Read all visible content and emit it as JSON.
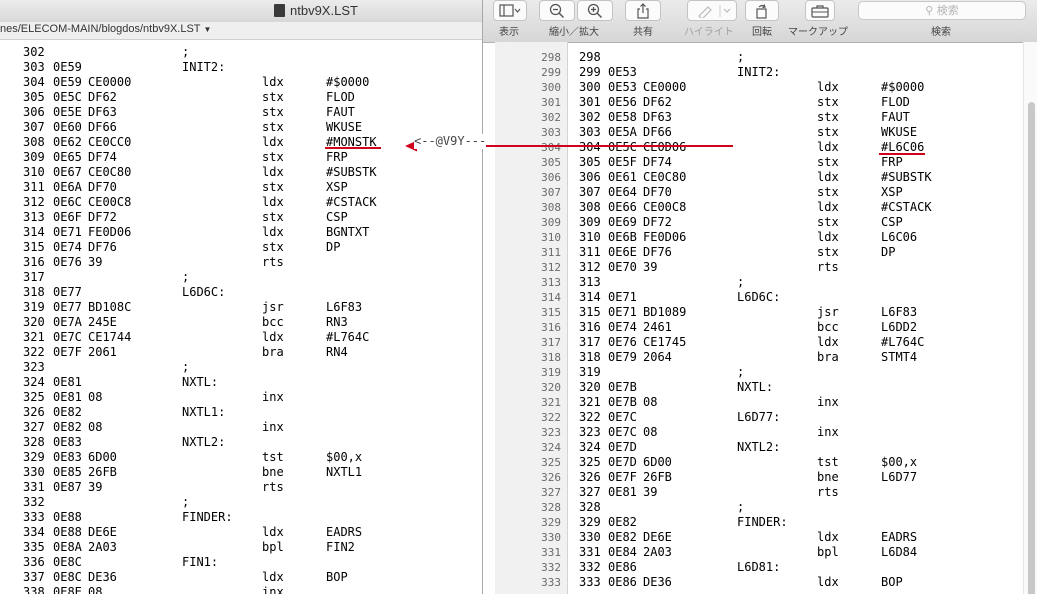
{
  "left_window": {
    "title": "ntbv9X.LST",
    "path": "nes/ELECOM-MAIN/blogdos/ntbv9X.LST",
    "lines": [
      {
        "c1": "302",
        "c2": "",
        "c3": "",
        "c4": ";",
        "c5": "",
        "c6": ""
      },
      {
        "c1": "303",
        "c2": "0E59",
        "c3": "",
        "c4": "INIT2:",
        "c5": "",
        "c6": ""
      },
      {
        "c1": "304",
        "c2": "0E59",
        "c3": "CE0000",
        "c4": "",
        "c5": "ldx",
        "c6": "#$0000"
      },
      {
        "c1": "305",
        "c2": "0E5C",
        "c3": "DF62",
        "c4": "",
        "c5": "stx",
        "c6": "FLOD"
      },
      {
        "c1": "306",
        "c2": "0E5E",
        "c3": "DF63",
        "c4": "",
        "c5": "stx",
        "c6": "FAUT"
      },
      {
        "c1": "307",
        "c2": "0E60",
        "c3": "DF66",
        "c4": "",
        "c5": "stx",
        "c6": "WKUSE"
      },
      {
        "c1": "308",
        "c2": "0E62",
        "c3": "CE0CC0",
        "c4": "",
        "c5": "ldx",
        "c6": "#MONSTK"
      },
      {
        "c1": "309",
        "c2": "0E65",
        "c3": "DF74",
        "c4": "",
        "c5": "stx",
        "c6": "FRP"
      },
      {
        "c1": "310",
        "c2": "0E67",
        "c3": "CE0C80",
        "c4": "",
        "c5": "ldx",
        "c6": "#SUBSTK"
      },
      {
        "c1": "311",
        "c2": "0E6A",
        "c3": "DF70",
        "c4": "",
        "c5": "stx",
        "c6": "XSP"
      },
      {
        "c1": "312",
        "c2": "0E6C",
        "c3": "CE00C8",
        "c4": "",
        "c5": "ldx",
        "c6": "#CSTACK"
      },
      {
        "c1": "313",
        "c2": "0E6F",
        "c3": "DF72",
        "c4": "",
        "c5": "stx",
        "c6": "CSP"
      },
      {
        "c1": "314",
        "c2": "0E71",
        "c3": "FE0D06",
        "c4": "",
        "c5": "ldx",
        "c6": "BGNTXT"
      },
      {
        "c1": "315",
        "c2": "0E74",
        "c3": "DF76",
        "c4": "",
        "c5": "stx",
        "c6": "DP"
      },
      {
        "c1": "316",
        "c2": "0E76",
        "c3": "39",
        "c4": "",
        "c5": "rts",
        "c6": ""
      },
      {
        "c1": "317",
        "c2": "",
        "c3": "",
        "c4": ";",
        "c5": "",
        "c6": ""
      },
      {
        "c1": "318",
        "c2": "0E77",
        "c3": "",
        "c4": "L6D6C:",
        "c5": "",
        "c6": ""
      },
      {
        "c1": "319",
        "c2": "0E77",
        "c3": "BD108C",
        "c4": "",
        "c5": "jsr",
        "c6": "L6F83"
      },
      {
        "c1": "320",
        "c2": "0E7A",
        "c3": "245E",
        "c4": "",
        "c5": "bcc",
        "c6": "RN3"
      },
      {
        "c1": "321",
        "c2": "0E7C",
        "c3": "CE1744",
        "c4": "",
        "c5": "ldx",
        "c6": "#L764C"
      },
      {
        "c1": "322",
        "c2": "0E7F",
        "c3": "2061",
        "c4": "",
        "c5": "bra",
        "c6": "RN4"
      },
      {
        "c1": "323",
        "c2": "",
        "c3": "",
        "c4": ";",
        "c5": "",
        "c6": ""
      },
      {
        "c1": "324",
        "c2": "0E81",
        "c3": "",
        "c4": "NXTL:",
        "c5": "",
        "c6": ""
      },
      {
        "c1": "325",
        "c2": "0E81",
        "c3": "08",
        "c4": "",
        "c5": "inx",
        "c6": ""
      },
      {
        "c1": "326",
        "c2": "0E82",
        "c3": "",
        "c4": "NXTL1:",
        "c5": "",
        "c6": ""
      },
      {
        "c1": "327",
        "c2": "0E82",
        "c3": "08",
        "c4": "",
        "c5": "inx",
        "c6": ""
      },
      {
        "c1": "328",
        "c2": "0E83",
        "c3": "",
        "c4": "NXTL2:",
        "c5": "",
        "c6": ""
      },
      {
        "c1": "329",
        "c2": "0E83",
        "c3": "6D00",
        "c4": "",
        "c5": "tst",
        "c6": "$00,x"
      },
      {
        "c1": "330",
        "c2": "0E85",
        "c3": "26FB",
        "c4": "",
        "c5": "bne",
        "c6": "NXTL1"
      },
      {
        "c1": "331",
        "c2": "0E87",
        "c3": "39",
        "c4": "",
        "c5": "rts",
        "c6": ""
      },
      {
        "c1": "332",
        "c2": "",
        "c3": "",
        "c4": ";",
        "c5": "",
        "c6": ""
      },
      {
        "c1": "333",
        "c2": "0E88",
        "c3": "",
        "c4": "FINDER:",
        "c5": "",
        "c6": ""
      },
      {
        "c1": "334",
        "c2": "0E88",
        "c3": "DE6E",
        "c4": "",
        "c5": "ldx",
        "c6": "EADRS"
      },
      {
        "c1": "335",
        "c2": "0E8A",
        "c3": "2A03",
        "c4": "",
        "c5": "bpl",
        "c6": "FIN2"
      },
      {
        "c1": "336",
        "c2": "0E8C",
        "c3": "",
        "c4": "FIN1:",
        "c5": "",
        "c6": ""
      },
      {
        "c1": "337",
        "c2": "0E8C",
        "c3": "DE36",
        "c4": "",
        "c5": "ldx",
        "c6": "BOP"
      },
      {
        "c1": "338",
        "c2": "0E8E",
        "c3": "08",
        "c4": "",
        "c5": "inx",
        "c6": ""
      }
    ]
  },
  "annotation": {
    "label": "<--@V9Y---",
    "arrow_color": "#d0021b"
  },
  "toolbar": {
    "view_label": "表示",
    "zoom_label": "縮小／拡大",
    "share_label": "共有",
    "highlight_label": "ハイライト",
    "rotate_label": "回転",
    "markup_label": "マークアップ",
    "search_placeholder": "検索",
    "search_label": "検索"
  },
  "right_window": {
    "lines": [
      {
        "g": "298",
        "c1": "298",
        "c2": "",
        "c3": "",
        "c4": ";",
        "c5": "",
        "c6": ""
      },
      {
        "g": "299",
        "c1": "299",
        "c2": "0E53",
        "c3": "",
        "c4": "INIT2:",
        "c5": "",
        "c6": ""
      },
      {
        "g": "300",
        "c1": "300",
        "c2": "0E53",
        "c3": "CE0000",
        "c4": "",
        "c5": "ldx",
        "c6": "#$0000"
      },
      {
        "g": "301",
        "c1": "301",
        "c2": "0E56",
        "c3": "DF62",
        "c4": "",
        "c5": "stx",
        "c6": "FLOD"
      },
      {
        "g": "302",
        "c1": "302",
        "c2": "0E58",
        "c3": "DF63",
        "c4": "",
        "c5": "stx",
        "c6": "FAUT"
      },
      {
        "g": "303",
        "c1": "303",
        "c2": "0E5A",
        "c3": "DF66",
        "c4": "",
        "c5": "stx",
        "c6": "WKUSE"
      },
      {
        "g": "304",
        "c1": "304",
        "c2": "0E5C",
        "c3": "CE0D06",
        "c4": "",
        "c5": "ldx",
        "c6": "#L6C06"
      },
      {
        "g": "305",
        "c1": "305",
        "c2": "0E5F",
        "c3": "DF74",
        "c4": "",
        "c5": "stx",
        "c6": "FRP"
      },
      {
        "g": "306",
        "c1": "306",
        "c2": "0E61",
        "c3": "CE0C80",
        "c4": "",
        "c5": "ldx",
        "c6": "#SUBSTK"
      },
      {
        "g": "307",
        "c1": "307",
        "c2": "0E64",
        "c3": "DF70",
        "c4": "",
        "c5": "stx",
        "c6": "XSP"
      },
      {
        "g": "308",
        "c1": "308",
        "c2": "0E66",
        "c3": "CE00C8",
        "c4": "",
        "c5": "ldx",
        "c6": "#CSTACK"
      },
      {
        "g": "309",
        "c1": "309",
        "c2": "0E69",
        "c3": "DF72",
        "c4": "",
        "c5": "stx",
        "c6": "CSP"
      },
      {
        "g": "310",
        "c1": "310",
        "c2": "0E6B",
        "c3": "FE0D06",
        "c4": "",
        "c5": "ldx",
        "c6": "L6C06"
      },
      {
        "g": "311",
        "c1": "311",
        "c2": "0E6E",
        "c3": "DF76",
        "c4": "",
        "c5": "stx",
        "c6": "DP"
      },
      {
        "g": "312",
        "c1": "312",
        "c2": "0E70",
        "c3": "39",
        "c4": "",
        "c5": "rts",
        "c6": ""
      },
      {
        "g": "313",
        "c1": "313",
        "c2": "",
        "c3": "",
        "c4": ";",
        "c5": "",
        "c6": ""
      },
      {
        "g": "314",
        "c1": "314",
        "c2": "0E71",
        "c3": "",
        "c4": "L6D6C:",
        "c5": "",
        "c6": ""
      },
      {
        "g": "315",
        "c1": "315",
        "c2": "0E71",
        "c3": "BD1089",
        "c4": "",
        "c5": "jsr",
        "c6": "L6F83"
      },
      {
        "g": "316",
        "c1": "316",
        "c2": "0E74",
        "c3": "2461",
        "c4": "",
        "c5": "bcc",
        "c6": "L6DD2"
      },
      {
        "g": "317",
        "c1": "317",
        "c2": "0E76",
        "c3": "CE1745",
        "c4": "",
        "c5": "ldx",
        "c6": "#L764C"
      },
      {
        "g": "318",
        "c1": "318",
        "c2": "0E79",
        "c3": "2064",
        "c4": "",
        "c5": "bra",
        "c6": "STMT4"
      },
      {
        "g": "319",
        "c1": "319",
        "c2": "",
        "c3": "",
        "c4": ";",
        "c5": "",
        "c6": ""
      },
      {
        "g": "320",
        "c1": "320",
        "c2": "0E7B",
        "c3": "",
        "c4": "NXTL:",
        "c5": "",
        "c6": ""
      },
      {
        "g": "321",
        "c1": "321",
        "c2": "0E7B",
        "c3": "08",
        "c4": "",
        "c5": "inx",
        "c6": ""
      },
      {
        "g": "322",
        "c1": "322",
        "c2": "0E7C",
        "c3": "",
        "c4": "L6D77:",
        "c5": "",
        "c6": ""
      },
      {
        "g": "323",
        "c1": "323",
        "c2": "0E7C",
        "c3": "08",
        "c4": "",
        "c5": "inx",
        "c6": ""
      },
      {
        "g": "324",
        "c1": "324",
        "c2": "0E7D",
        "c3": "",
        "c4": "NXTL2:",
        "c5": "",
        "c6": ""
      },
      {
        "g": "325",
        "c1": "325",
        "c2": "0E7D",
        "c3": "6D00",
        "c4": "",
        "c5": "tst",
        "c6": "$00,x"
      },
      {
        "g": "326",
        "c1": "326",
        "c2": "0E7F",
        "c3": "26FB",
        "c4": "",
        "c5": "bne",
        "c6": "L6D77"
      },
      {
        "g": "327",
        "c1": "327",
        "c2": "0E81",
        "c3": "39",
        "c4": "",
        "c5": "rts",
        "c6": ""
      },
      {
        "g": "328",
        "c1": "328",
        "c2": "",
        "c3": "",
        "c4": ";",
        "c5": "",
        "c6": ""
      },
      {
        "g": "329",
        "c1": "329",
        "c2": "0E82",
        "c3": "",
        "c4": "FINDER:",
        "c5": "",
        "c6": ""
      },
      {
        "g": "330",
        "c1": "330",
        "c2": "0E82",
        "c3": "DE6E",
        "c4": "",
        "c5": "ldx",
        "c6": "EADRS"
      },
      {
        "g": "331",
        "c1": "331",
        "c2": "0E84",
        "c3": "2A03",
        "c4": "",
        "c5": "bpl",
        "c6": "L6D84"
      },
      {
        "g": "332",
        "c1": "332",
        "c2": "0E86",
        "c3": "",
        "c4": "L6D81:",
        "c5": "",
        "c6": ""
      },
      {
        "g": "333",
        "c1": "333",
        "c2": "0E86",
        "c3": "DE36",
        "c4": "",
        "c5": "ldx",
        "c6": "BOP"
      }
    ]
  }
}
